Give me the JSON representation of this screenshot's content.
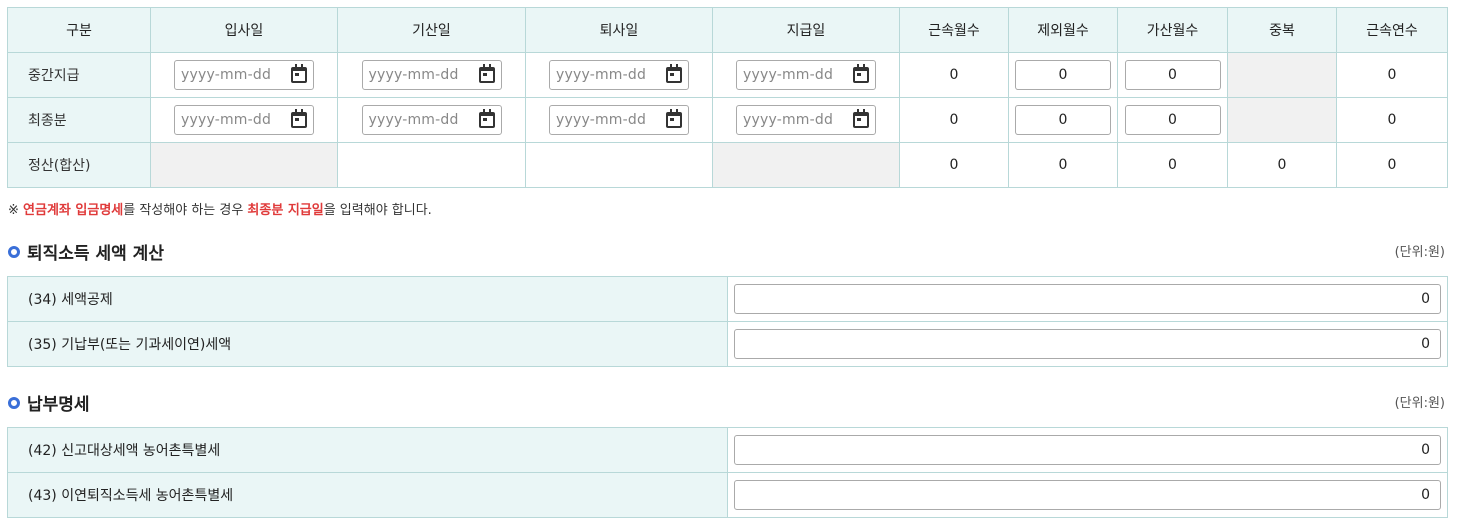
{
  "period_table": {
    "headers": [
      "구분",
      "입사일",
      "기산일",
      "퇴사일",
      "지급일",
      "근속월수",
      "제외월수",
      "가산월수",
      "중복",
      "근속연수"
    ],
    "date_placeholder": "yyyy-mm-dd",
    "rows": [
      {
        "label": "중간지급",
        "months": "0",
        "excluded": "0",
        "added": "0",
        "years": "0"
      },
      {
        "label": "최종분",
        "months": "0",
        "excluded": "0",
        "added": "0",
        "years": "0"
      },
      {
        "label": "정산(합산)",
        "months": "0",
        "excluded": "0",
        "added": "0",
        "duplicate": "0",
        "years": "0"
      }
    ]
  },
  "note": {
    "prefix": "※ ",
    "highlight1": "연금계좌 입금명세",
    "middle": "를 작성해야 하는 경우 ",
    "highlight2": "최종분 지급일",
    "suffix": "을 입력해야 합니다."
  },
  "tax_section": {
    "title": "퇴직소득 세액 계산",
    "unit": "(단위:원)",
    "rows": [
      {
        "label": "(34) 세액공제",
        "value": "0"
      },
      {
        "label": "(35) 기납부(또는 기과세이연)세액",
        "value": "0"
      }
    ]
  },
  "payment_section": {
    "title": "납부명세",
    "unit": "(단위:원)",
    "rows": [
      {
        "label": "(42) 신고대상세액 농어촌특별세",
        "value": "0"
      },
      {
        "label": "(43) 이연퇴직소득세 농어촌특별세",
        "value": "0"
      }
    ]
  },
  "colors": {
    "header_bg": "#eaf6f6",
    "border": "#b8d8d8",
    "highlight": "#e03a3a",
    "bullet": "#3a6fd8",
    "disabled_bg": "#f1f1f1"
  }
}
